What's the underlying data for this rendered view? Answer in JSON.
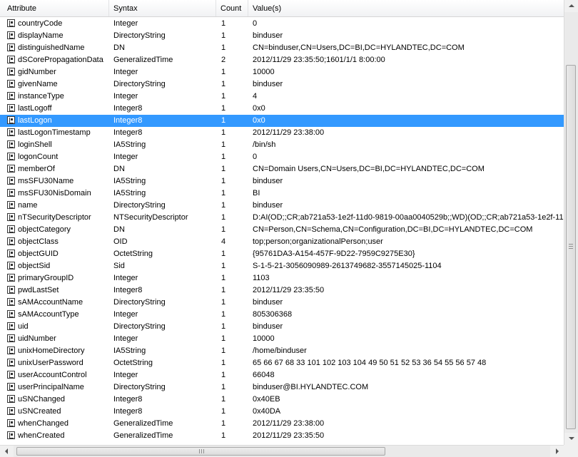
{
  "columns": [
    "Attribute",
    "Syntax",
    "Count",
    "Value(s)"
  ],
  "rows": [
    {
      "attribute": "countryCode",
      "syntax": "Integer",
      "count": "1",
      "value": "0"
    },
    {
      "attribute": "displayName",
      "syntax": "DirectoryString",
      "count": "1",
      "value": "binduser"
    },
    {
      "attribute": "distinguishedName",
      "syntax": "DN",
      "count": "1",
      "value": "CN=binduser,CN=Users,DC=BI,DC=HYLANDTEC,DC=COM"
    },
    {
      "attribute": "dSCorePropagationData",
      "syntax": "GeneralizedTime",
      "count": "2",
      "value": "2012/11/29 23:35:50;1601/1/1 8:00:00"
    },
    {
      "attribute": "gidNumber",
      "syntax": "Integer",
      "count": "1",
      "value": "10000"
    },
    {
      "attribute": "givenName",
      "syntax": "DirectoryString",
      "count": "1",
      "value": "binduser"
    },
    {
      "attribute": "instanceType",
      "syntax": "Integer",
      "count": "1",
      "value": "4"
    },
    {
      "attribute": "lastLogoff",
      "syntax": "Integer8",
      "count": "1",
      "value": "0x0"
    },
    {
      "attribute": "lastLogon",
      "syntax": "Integer8",
      "count": "1",
      "value": "0x0",
      "selected": true
    },
    {
      "attribute": "lastLogonTimestamp",
      "syntax": "Integer8",
      "count": "1",
      "value": "2012/11/29 23:38:00"
    },
    {
      "attribute": "loginShell",
      "syntax": "IA5String",
      "count": "1",
      "value": "/bin/sh"
    },
    {
      "attribute": "logonCount",
      "syntax": "Integer",
      "count": "1",
      "value": "0"
    },
    {
      "attribute": "memberOf",
      "syntax": "DN",
      "count": "1",
      "value": "CN=Domain Users,CN=Users,DC=BI,DC=HYLANDTEC,DC=COM"
    },
    {
      "attribute": "msSFU30Name",
      "syntax": "IA5String",
      "count": "1",
      "value": "binduser"
    },
    {
      "attribute": "msSFU30NisDomain",
      "syntax": "IA5String",
      "count": "1",
      "value": "BI"
    },
    {
      "attribute": "name",
      "syntax": "DirectoryString",
      "count": "1",
      "value": "binduser"
    },
    {
      "attribute": "nTSecurityDescriptor",
      "syntax": "NTSecurityDescriptor",
      "count": "1",
      "value": "D:AI(OD;;CR;ab721a53-1e2f-11d0-9819-00aa0040529b;;WD)(OD;;CR;ab721a53-1e2f-11"
    },
    {
      "attribute": "objectCategory",
      "syntax": "DN",
      "count": "1",
      "value": "CN=Person,CN=Schema,CN=Configuration,DC=BI,DC=HYLANDTEC,DC=COM"
    },
    {
      "attribute": "objectClass",
      "syntax": "OID",
      "count": "4",
      "value": "top;person;organizationalPerson;user"
    },
    {
      "attribute": "objectGUID",
      "syntax": "OctetString",
      "count": "1",
      "value": "{95761DA3-A154-457F-9D22-7959C9275E30}"
    },
    {
      "attribute": "objectSid",
      "syntax": "Sid",
      "count": "1",
      "value": "S-1-5-21-3056090989-2613749682-3557145025-1104"
    },
    {
      "attribute": "primaryGroupID",
      "syntax": "Integer",
      "count": "1",
      "value": "1103"
    },
    {
      "attribute": "pwdLastSet",
      "syntax": "Integer8",
      "count": "1",
      "value": "2012/11/29 23:35:50"
    },
    {
      "attribute": "sAMAccountName",
      "syntax": "DirectoryString",
      "count": "1",
      "value": "binduser"
    },
    {
      "attribute": "sAMAccountType",
      "syntax": "Integer",
      "count": "1",
      "value": "805306368"
    },
    {
      "attribute": "uid",
      "syntax": "DirectoryString",
      "count": "1",
      "value": "binduser"
    },
    {
      "attribute": "uidNumber",
      "syntax": "Integer",
      "count": "1",
      "value": "10000"
    },
    {
      "attribute": "unixHomeDirectory",
      "syntax": "IA5String",
      "count": "1",
      "value": "/home/binduser"
    },
    {
      "attribute": "unixUserPassword",
      "syntax": "OctetString",
      "count": "1",
      "value": "65 66 67 68 33 101 102 103 104 49 50 51 52 53 36 54 55 56 57 48"
    },
    {
      "attribute": "userAccountControl",
      "syntax": "Integer",
      "count": "1",
      "value": "66048"
    },
    {
      "attribute": "userPrincipalName",
      "syntax": "DirectoryString",
      "count": "1",
      "value": "binduser@BI.HYLANDTEC.COM"
    },
    {
      "attribute": "uSNChanged",
      "syntax": "Integer8",
      "count": "1",
      "value": "0x40EB"
    },
    {
      "attribute": "uSNCreated",
      "syntax": "Integer8",
      "count": "1",
      "value": "0x40DA"
    },
    {
      "attribute": "whenChanged",
      "syntax": "GeneralizedTime",
      "count": "1",
      "value": "2012/11/29 23:38:00"
    },
    {
      "attribute": "whenCreated",
      "syntax": "GeneralizedTime",
      "count": "1",
      "value": "2012/11/29 23:35:50"
    }
  ],
  "icons": {
    "row": "attribute-icon"
  },
  "colors": {
    "selection": "#3399ff",
    "selection_text": "#ffffff"
  }
}
